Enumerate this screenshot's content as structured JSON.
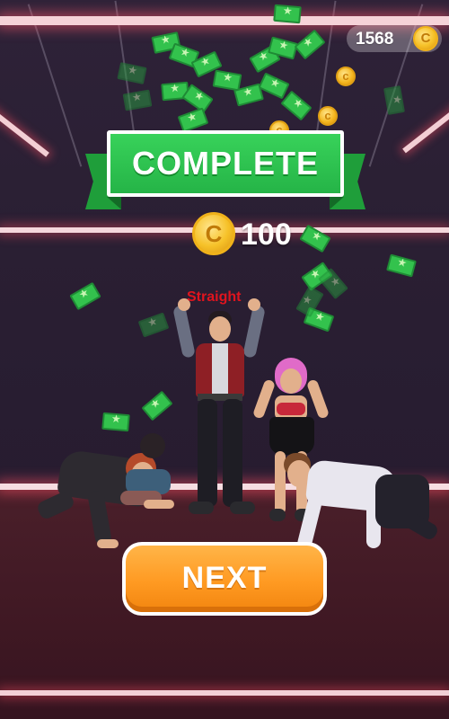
{
  "hud": {
    "coin_total": "1568",
    "coin_symbol": "C"
  },
  "banner": {
    "title": "COMPLETE"
  },
  "reward": {
    "coin_symbol": "C",
    "amount": "100"
  },
  "hit_label": "Straight",
  "next_button": {
    "label": "NEXT"
  },
  "colors": {
    "banner_green": "#25b447",
    "button_orange": "#ff9a22",
    "coin_gold": "#f6c128",
    "hit_text_red": "#e0141e",
    "neon_pink": "#f6d3d8"
  },
  "icons": {
    "coin": "gold-coin-icon",
    "money": "cash-bill-icon"
  }
}
